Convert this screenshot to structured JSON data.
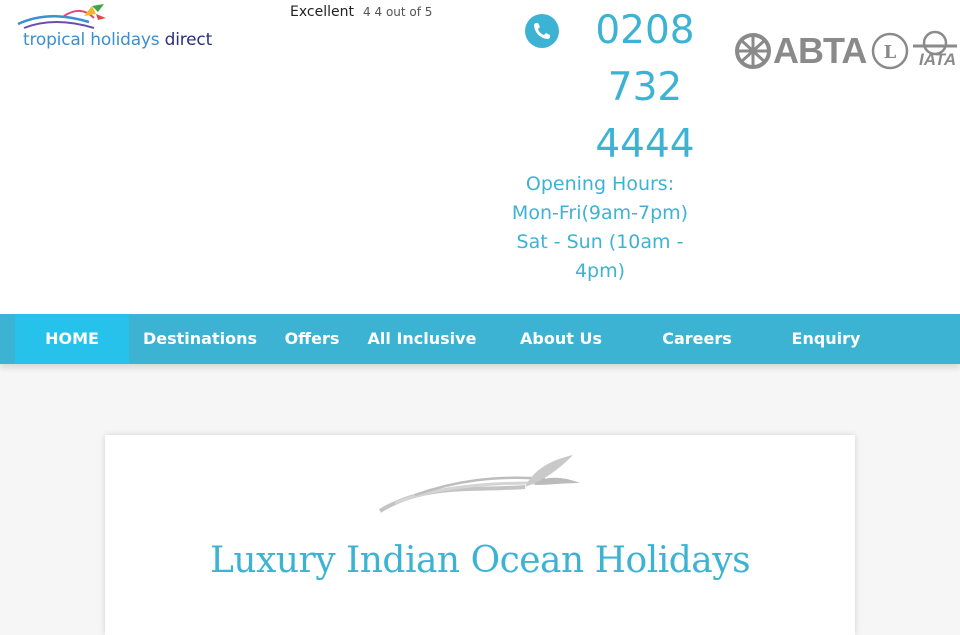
{
  "brand": {
    "logo_part1": "tropical holidays ",
    "logo_part2": "direct",
    "colors": {
      "primary": "#3db3d4",
      "active_tab": "#26c2ec",
      "logo_blue": "#3a8fd0",
      "logo_navy": "#2a2f80"
    }
  },
  "rating": {
    "label": "Excellent",
    "score_text": "4 4 out of 5"
  },
  "contact": {
    "phone_icon": "phone-icon",
    "phone": "0208 732 4444",
    "hours_title": "Opening Hours:",
    "hours_weekday": "Mon-Fri(9am-7pm)",
    "hours_weekend": "Sat - Sun (10am - 4pm)"
  },
  "accreditations": {
    "abta": "ABTA",
    "iata": "IATA"
  },
  "nav": {
    "items": [
      {
        "label": "HOME",
        "active": true
      },
      {
        "label": "Destinations"
      },
      {
        "label": "Offers"
      },
      {
        "label": "All Inclusive"
      },
      {
        "label": "About Us"
      },
      {
        "label": "Careers"
      },
      {
        "label": "Enquiry"
      }
    ]
  },
  "hero": {
    "title": "Luxury Indian Ocean Holidays"
  }
}
